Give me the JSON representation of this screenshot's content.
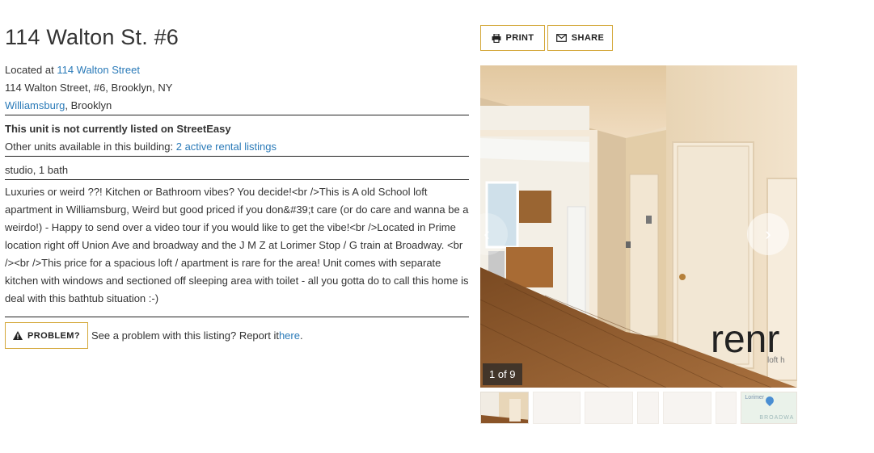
{
  "listing": {
    "title": "114 Walton St. #6",
    "located_prefix": "Located at ",
    "building_link": "114 Walton Street",
    "address": "114 Walton Street, #6, Brooklyn, NY",
    "neighborhood_link": "Williamsburg",
    "borough_suffix": ", Brooklyn",
    "status_notice": "This unit is not currently listed on StreetEasy",
    "other_units_prefix": "Other units available in this building: ",
    "other_units_link": "2 active rental listings",
    "unit_details": "studio, 1 bath",
    "description": "Luxuries or weird ??! Kitchen or Bathroom vibes? You decide!<br />This is A old School loft apartment in Williamsburg, Weird but good priced if you don&#39;t care (or do care and wanna be a weirdo!) - Happy to send over a video tour if you would like to get the vibe!<br />Located in Prime location right off Union Ave and broadway and the J M Z at Lorimer Stop / G train at Broadway. <br /><br />This price for a spacious loft / apartment is rare for the area! Unit comes with separate kitchen with windows and sectioned off sleeping area with toilet - all you gotta do to call this home is deal with this bathtub situation :-)"
  },
  "problem": {
    "button_label": "PROBLEM?",
    "prompt": "See a problem with this listing? Report it ",
    "link": "here",
    "suffix": "."
  },
  "actions": {
    "print_label": "PRINT",
    "share_label": "SHARE"
  },
  "gallery": {
    "counter": "1 of 9",
    "watermark": "renr",
    "watermark_sub": "loft h",
    "next_glyph": "›",
    "prev_glyph": "‹",
    "map_thumb_labels": [
      "Lorimer",
      "BROADWA"
    ]
  },
  "colors": {
    "accent_border": "#d4a83a",
    "link": "#2a7ab8",
    "map_pin": "#1e73c8"
  }
}
